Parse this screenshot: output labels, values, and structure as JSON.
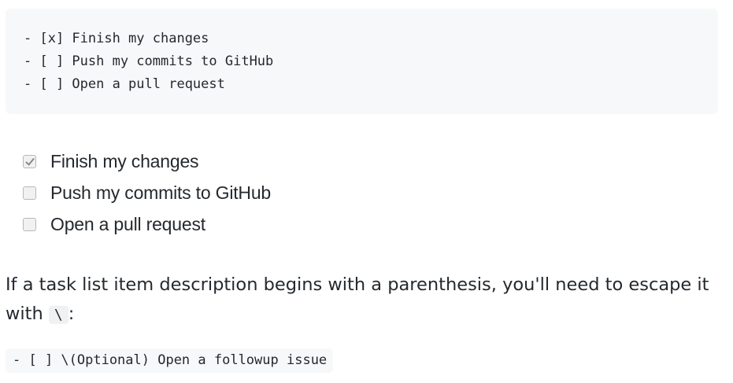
{
  "markdown_example": {
    "lines": [
      "- [x] Finish my changes",
      "- [ ] Push my commits to GitHub",
      "- [ ] Open a pull request"
    ]
  },
  "rendered_task_list": {
    "items": [
      {
        "label": "Finish my changes",
        "checked": true
      },
      {
        "label": "Push my commits to GitHub",
        "checked": false
      },
      {
        "label": "Open a pull request",
        "checked": false
      }
    ]
  },
  "note": {
    "text": "If a task list item description begins with a parenthesis, you'll need to escape it with ",
    "code": "\\",
    "suffix": ":"
  },
  "escape_example": {
    "code": "- [ ] \\(Optional) Open a followup issue"
  }
}
